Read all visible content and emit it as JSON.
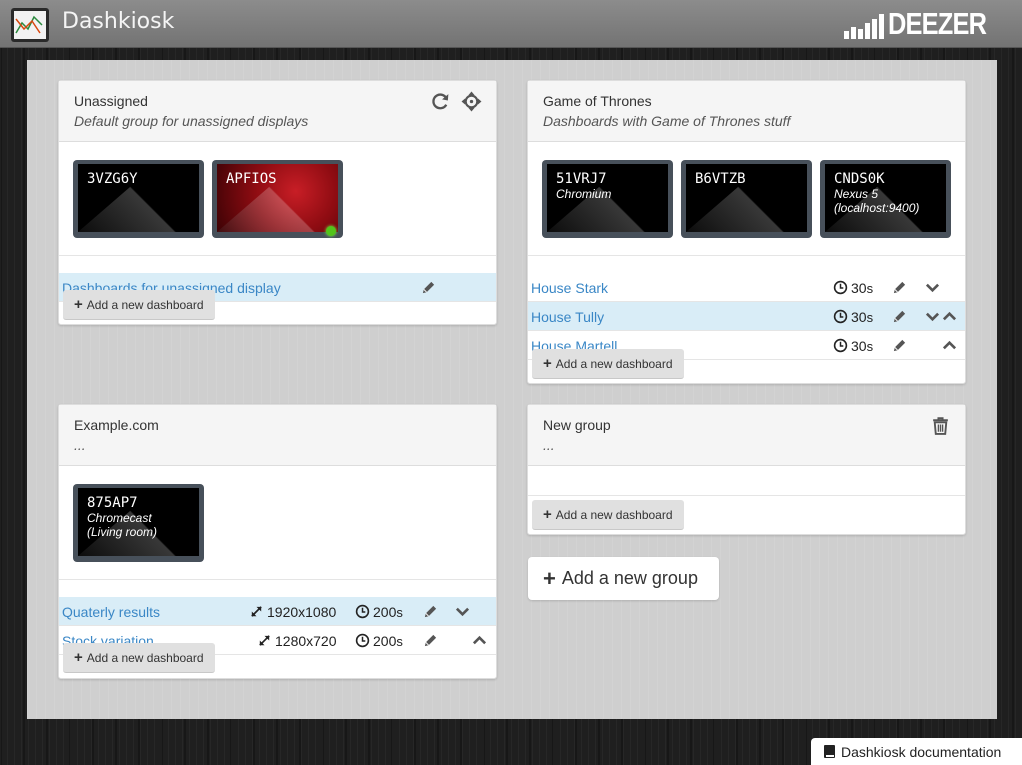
{
  "app": {
    "title": "Dashkiosk",
    "brand": "DEEZER"
  },
  "groups": [
    {
      "title": "Unassigned",
      "description": "Default group for unassigned displays",
      "displays": [
        {
          "id": "3VZG6Y",
          "desc": "",
          "online": false
        },
        {
          "id": "APFIOS",
          "desc": "",
          "online": true
        }
      ],
      "dashboards": [
        {
          "name": "Dashboards for unassigned display",
          "active": true
        }
      ],
      "add_label": "Add a new dashboard"
    },
    {
      "title": "Game of Thrones",
      "description": "Dashboards with Game of Thrones stuff",
      "displays": [
        {
          "id": "51VRJ7",
          "desc": "Chromium"
        },
        {
          "id": "B6VTZB",
          "desc": ""
        },
        {
          "id": "CNDS0K",
          "desc1": "Nexus 5",
          "desc2": "(localhost:9400)"
        }
      ],
      "dashboards": [
        {
          "name": "House Stark",
          "timeout": "30",
          "unit": "s",
          "active": false
        },
        {
          "name": "House Tully",
          "timeout": "30",
          "unit": "s",
          "active": true
        },
        {
          "name": "House Martell",
          "timeout": "30",
          "unit": "s",
          "active": false
        }
      ],
      "add_label": "Add a new dashboard"
    },
    {
      "title": "Example.com",
      "description": "...",
      "displays": [
        {
          "id": "875AP7",
          "desc1": "Chromecast",
          "desc2": "(Living room)"
        }
      ],
      "dashboards": [
        {
          "name": "Quaterly results",
          "resolution": "1920x1080",
          "timeout": "200",
          "unit": "s",
          "active": true
        },
        {
          "name": "Stock variation",
          "resolution": "1280x720",
          "timeout": "200",
          "unit": "s",
          "active": false
        }
      ],
      "add_label": "Add a new dashboard"
    },
    {
      "title": "New group",
      "description": "...",
      "add_label": "Add a new dashboard"
    }
  ],
  "add_group_label": "Add a new group",
  "docs_label": "Dashkiosk documentation",
  "colors": {
    "link": "#3a87c6",
    "active_row": "#d9edf7",
    "online": "#52c41a"
  }
}
